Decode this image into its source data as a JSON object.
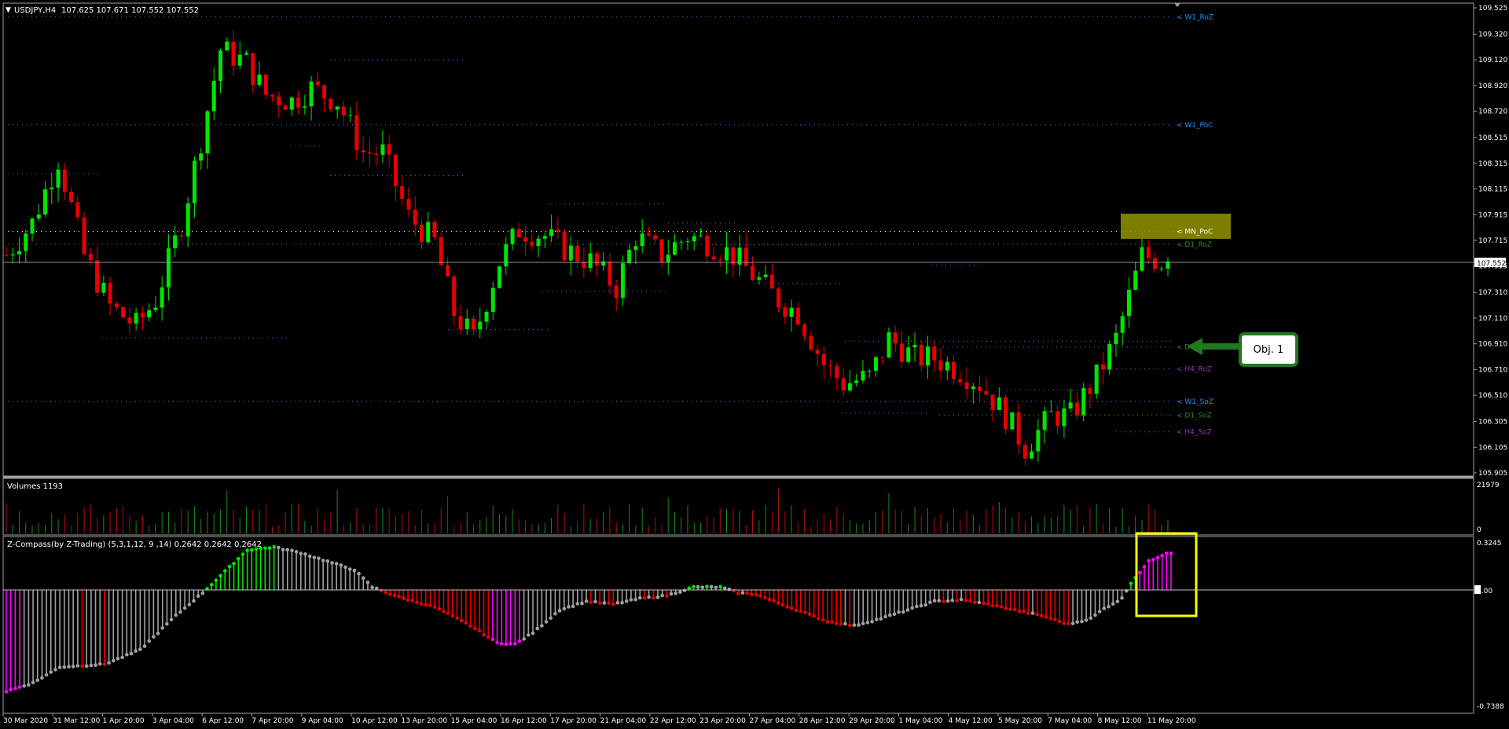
{
  "window": {
    "symbol_title": "USDJPY,H4",
    "ohlc": "107.625 107.671 107.552 107.552",
    "menu_marker": "▼"
  },
  "price_scale": {
    "labels": [
      "109.525",
      "109.320",
      "109.120",
      "108.920",
      "108.720",
      "108.515",
      "108.315",
      "108.115",
      "107.915",
      "107.715",
      "107.515",
      "107.310",
      "107.110",
      "106.910",
      "106.710",
      "106.510",
      "106.305",
      "106.105",
      "105.905"
    ],
    "current_price": "107.552",
    "min": 105.905,
    "max": 109.525
  },
  "level_tags": [
    {
      "text": "< W1_RoZ",
      "price": 109.455,
      "color": "#1e90ff"
    },
    {
      "text": "< W1_PoC",
      "price": 108.615,
      "color": "#1e90ff"
    },
    {
      "text": "< MN_PoC",
      "price": 107.785,
      "color": "#ffffff"
    },
    {
      "text": "< D1_RoZ",
      "price": 107.685,
      "color": "#2e8b2e"
    },
    {
      "text": "< D1_PoC",
      "price": 106.885,
      "color": "#2e8b2e"
    },
    {
      "text": "< H4_RoZ",
      "price": 106.715,
      "color": "#9932cc"
    },
    {
      "text": "< W1_SoZ",
      "price": 106.46,
      "color": "#1e90ff"
    },
    {
      "text": "< D1_SoZ",
      "price": 106.355,
      "color": "#2e8b2e"
    },
    {
      "text": "< H4_SoZ",
      "price": 106.225,
      "color": "#9932cc"
    }
  ],
  "annotation": {
    "objective_label": "Obj. 1",
    "callout_color": "#1f7a1f",
    "highlight_color": "#8b8b00",
    "box_color": "#ffff00"
  },
  "volumes_panel": {
    "title": "Volumes 1193",
    "max_label": "21979",
    "min_label": "0"
  },
  "zcompass_panel": {
    "title": "Z-Compass(by Z-Trading) (5,3,1,12, 9 ,14) 0.2642 0.2642 0.2642",
    "max_label": "0.3245",
    "zero_label": "0.00",
    "min_label": "-0.7388"
  },
  "time_axis": {
    "labels": [
      "30 Mar 2020",
      "31 Mar 12:00",
      "1 Apr 20:00",
      "3 Apr 04:00",
      "6 Apr 12:00",
      "7 Apr 20:00",
      "9 Apr 04:00",
      "10 Apr 12:00",
      "13 Apr 20:00",
      "15 Apr 04:00",
      "16 Apr 12:00",
      "17 Apr 20:00",
      "21 Apr 04:00",
      "22 Apr 12:00",
      "23 Apr 20:00",
      "27 Apr 04:00",
      "28 Apr 12:00",
      "29 Apr 20:00",
      "1 May 04:00",
      "4 May 12:00",
      "5 May 20:00",
      "7 May 04:00",
      "8 May 12:00",
      "11 May 20:00"
    ]
  },
  "colors": {
    "bull": "#00e600",
    "bear": "#e60000",
    "magenta": "#ff00ff",
    "gray": "#a0a0a0",
    "grid": "#808080"
  },
  "chart_data": {
    "type": "candlestick",
    "symbol": "USDJPY",
    "timeframe": "H4",
    "price_range": [
      105.905,
      109.525
    ],
    "last_close": 107.552,
    "close_path": [
      [
        0,
        107.6
      ],
      [
        4,
        107.85
      ],
      [
        8,
        108.35
      ],
      [
        12,
        107.6
      ],
      [
        16,
        107.2
      ],
      [
        20,
        107.05
      ],
      [
        23,
        107.25
      ],
      [
        27,
        107.85
      ],
      [
        30,
        108.5
      ],
      [
        33,
        109.2
      ],
      [
        37,
        109.1
      ],
      [
        40,
        108.85
      ],
      [
        44,
        108.8
      ],
      [
        47,
        108.9
      ],
      [
        51,
        108.8
      ],
      [
        55,
        108.4
      ],
      [
        58,
        108.4
      ],
      [
        62,
        107.9
      ],
      [
        66,
        107.7
      ],
      [
        69,
        107.15
      ],
      [
        72,
        106.95
      ],
      [
        76,
        107.55
      ],
      [
        79,
        107.8
      ],
      [
        83,
        107.75
      ],
      [
        86,
        107.65
      ],
      [
        90,
        107.55
      ],
      [
        94,
        107.35
      ],
      [
        97,
        107.75
      ],
      [
        101,
        107.6
      ],
      [
        105,
        107.75
      ],
      [
        108,
        107.7
      ],
      [
        112,
        107.6
      ],
      [
        115,
        107.45
      ],
      [
        119,
        107.25
      ],
      [
        122,
        107.15
      ],
      [
        126,
        106.75
      ],
      [
        129,
        106.6
      ],
      [
        133,
        106.65
      ],
      [
        136,
        106.95
      ],
      [
        140,
        106.8
      ],
      [
        143,
        106.8
      ],
      [
        147,
        106.7
      ],
      [
        150,
        106.6
      ],
      [
        154,
        106.35
      ],
      [
        157,
        106.1
      ],
      [
        161,
        106.35
      ],
      [
        164,
        106.35
      ],
      [
        168,
        106.65
      ],
      [
        171,
        106.95
      ],
      [
        175,
        107.6
      ],
      [
        178,
        107.552
      ]
    ]
  }
}
